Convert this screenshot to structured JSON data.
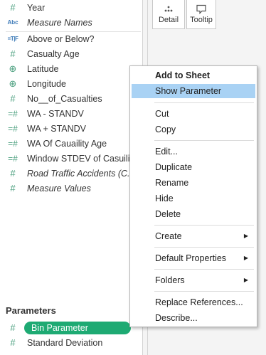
{
  "fields": [
    {
      "icon": "#",
      "type": "measure",
      "label": "Year",
      "italic": false
    },
    {
      "icon": "Abc",
      "type": "string",
      "label": "Measure Names",
      "italic": true
    },
    {
      "icon": "=T|F",
      "type": "boolean",
      "label": "Above or Below?",
      "italic": false
    },
    {
      "icon": "#",
      "type": "measure",
      "label": "Casualty Age",
      "italic": false
    },
    {
      "icon": "⊕",
      "type": "geo",
      "label": "Latitude",
      "italic": false
    },
    {
      "icon": "⊕",
      "type": "geo",
      "label": "Longitude",
      "italic": false
    },
    {
      "icon": "#",
      "type": "measure",
      "label": "No__of_Casualties",
      "italic": false
    },
    {
      "icon": "=#",
      "type": "calc",
      "label": "WA - STANDV",
      "italic": false
    },
    {
      "icon": "=#",
      "type": "calc",
      "label": "WA + STANDV",
      "italic": false
    },
    {
      "icon": "=#",
      "type": "calc",
      "label": "WA Of Cauaility Age",
      "italic": false
    },
    {
      "icon": "=#",
      "type": "calc",
      "label": "Window STDEV of Casuility",
      "italic": false
    },
    {
      "icon": "#",
      "type": "measure",
      "label": "Road Traffic Accidents (C...",
      "italic": true
    },
    {
      "icon": "#",
      "type": "measure",
      "label": "Measure Values",
      "italic": true
    }
  ],
  "parameters": {
    "header": "Parameters",
    "items": [
      {
        "icon": "#",
        "label": "Bin Parameter",
        "selected": true
      },
      {
        "icon": "#",
        "label": "Standard Deviation",
        "selected": false
      }
    ]
  },
  "marks_cards": [
    {
      "label": "Detail",
      "icon": "detail-icon"
    },
    {
      "label": "Tooltip",
      "icon": "tooltip-icon"
    }
  ],
  "context_menu": {
    "items": [
      {
        "label": "Add to Sheet",
        "bold": true
      },
      {
        "label": "Show Parameter",
        "highlight": true
      },
      {
        "sep": true
      },
      {
        "label": "Cut"
      },
      {
        "label": "Copy"
      },
      {
        "sep": true
      },
      {
        "label": "Edit..."
      },
      {
        "label": "Duplicate"
      },
      {
        "label": "Rename"
      },
      {
        "label": "Hide"
      },
      {
        "label": "Delete"
      },
      {
        "sep": true
      },
      {
        "label": "Create",
        "submenu": true
      },
      {
        "sep": true
      },
      {
        "label": "Default Properties",
        "submenu": true
      },
      {
        "sep": true
      },
      {
        "label": "Folders",
        "submenu": true
      },
      {
        "sep": true
      },
      {
        "label": "Replace References..."
      },
      {
        "label": "Describe..."
      }
    ]
  },
  "colors": {
    "pill": "#1eaa73",
    "measure_icon": "#4a9f7e",
    "dimension_icon": "#3e7bb8",
    "menu_highlight": "#a9d2f4"
  },
  "arrow_glyph": "▶"
}
